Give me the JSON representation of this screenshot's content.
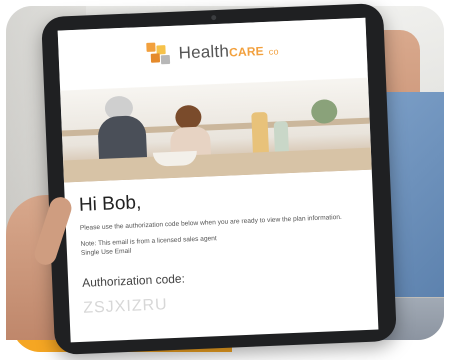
{
  "brand": {
    "name_main": "Health",
    "name_care": "CARE",
    "name_suffix": "co"
  },
  "email": {
    "greeting": "Hi Bob,",
    "body": "Please use the authorization code below when you are ready to view the plan information.",
    "note": "Note: This email is from a licensed sales agent",
    "note_line2": "Single Use Email",
    "auth_label": "Authorization code:",
    "auth_code": "ZSJXIZRU"
  },
  "colors": {
    "accent": "#f5a623",
    "brand_orange": "#f2a03d",
    "code_gray": "#d7d7d7"
  }
}
